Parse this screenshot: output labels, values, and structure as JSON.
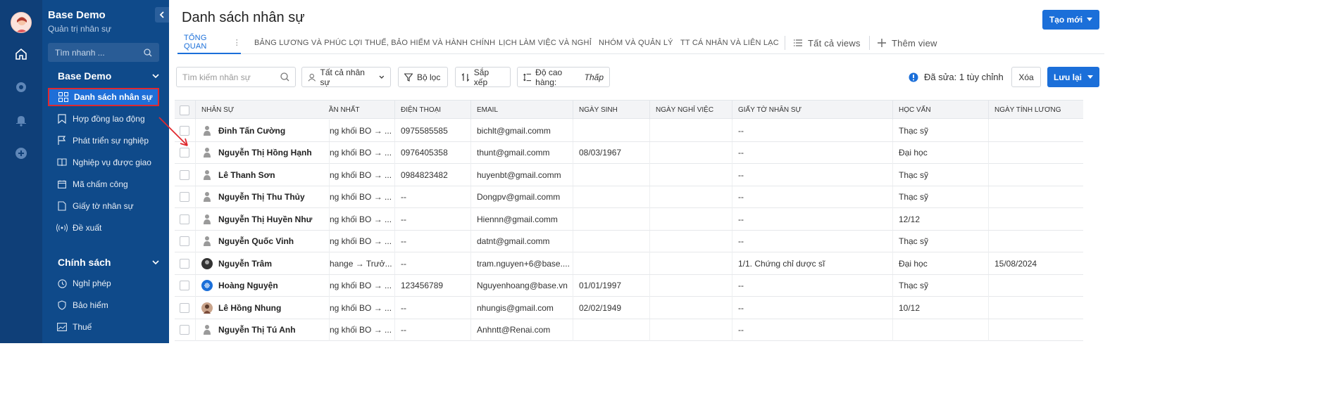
{
  "app": {
    "title": "Base Demo",
    "subtitle": "Quản trị nhân sự"
  },
  "sidebar": {
    "search_placeholder": "Tìm nhanh ...",
    "group1": "Base Demo",
    "items": [
      {
        "label": "Danh sách nhân sự",
        "icon": "grid-icon"
      },
      {
        "label": "Hợp đồng lao động",
        "icon": "bookmark-icon"
      },
      {
        "label": "Phát triển sự nghiệp",
        "icon": "flag-icon"
      },
      {
        "label": "Nghiệp vụ được giao",
        "icon": "book-icon"
      },
      {
        "label": "Mã chấm công",
        "icon": "calendar-icon"
      },
      {
        "label": "Giấy tờ nhân sự",
        "icon": "document-icon"
      },
      {
        "label": "Đề xuất",
        "icon": "broadcast-icon"
      }
    ],
    "group2": "Chính sách",
    "items2": [
      {
        "label": "Nghỉ phép",
        "icon": "clock-icon"
      },
      {
        "label": "Bảo hiểm",
        "icon": "shield-icon"
      },
      {
        "label": "Thuế",
        "icon": "image-icon"
      }
    ]
  },
  "main": {
    "title": "Danh sách nhân sự",
    "create_button": "Tạo mới",
    "tabs": [
      "TỔNG QUAN",
      "BẢNG LƯƠNG VÀ PHÚC LỢI",
      "THUẾ, BẢO HIỂM VÀ HÀNH CHÍNH",
      "LỊCH LÀM VIỆC VÀ NGHỈ",
      "NHÓM VÀ QUẢN LÝ",
      "TT CÁ NHÂN VÀ LIÊN LẠC"
    ],
    "all_views": "Tất cả views",
    "add_view": "Thêm view"
  },
  "toolbar": {
    "search_placeholder": "Tìm kiếm nhân sự",
    "all_staff": "Tất cả nhân sự",
    "filter": "Bộ lọc",
    "sort": "Sắp xếp",
    "row_height_label": "Độ cao hàng:",
    "row_height_value": "Thấp",
    "edited_text": "Đã sửa: 1 tùy chỉnh",
    "delete": "Xóa",
    "save": "Lưu lại"
  },
  "table": {
    "headers": [
      "NHÂN SỰ",
      "GẦN NHẤT",
      "ĐIỆN THOẠI",
      "EMAIL",
      "NGÀY SINH",
      "NGÀY NGHỈ VIỆC",
      "GIẤY TỜ NHÂN SỰ",
      "HỌC VẤN",
      "NGÀY TÍNH LƯƠNG"
    ],
    "header_visible": [
      "NHÂN SỰ",
      "GẦN NHẤT",
      "ĐIỆN THOẠI",
      "EMAIL",
      "NGÀY SINH",
      "NGÀY NGHỈ VIỆC",
      "GIẤY TỜ NHÂN SỰ",
      "HỌC VẤN",
      "NGÀY TÍNH LƯƠNG"
    ],
    "rows": [
      [
        "Đinh Tấn Cường",
        "ng khối BO → ...",
        "0975585585",
        "bichlt@gmail.comm",
        "",
        "",
        "--",
        "Thạc sỹ",
        ""
      ],
      [
        "Nguyễn Thị Hồng Hạnh",
        "ng khối BO → ...",
        "0976405358",
        "thunt@gmail.comm",
        "08/03/1967",
        "",
        "--",
        "Đại học",
        ""
      ],
      [
        "Lê Thanh Sơn",
        "ng khối BO → ...",
        "0984823482",
        "huyenbt@gmail.comm",
        "",
        "",
        "--",
        "Thạc sỹ",
        ""
      ],
      [
        "Nguyễn Thị Thu Thủy",
        "ng khối BO → ...",
        "--",
        "Dongpv@gmail.comm",
        "",
        "",
        "--",
        "Thạc sỹ",
        ""
      ],
      [
        "Nguyễn Thị Huyền Như",
        "ng khối BO → ...",
        "--",
        "Hiennn@gmail.comm",
        "",
        "",
        "--",
        "12/12",
        ""
      ],
      [
        "Nguyễn Quốc Vinh",
        "ng khối BO → ...",
        "--",
        "datnt@gmail.comm",
        "",
        "",
        "--",
        "Thạc sỹ",
        ""
      ],
      [
        "Nguyễn Trâm",
        "hange → Trưở...",
        "--",
        "tram.nguyen+6@base....",
        "",
        "",
        "1/1. Chứng chỉ dược sĩ",
        "Đại học",
        "15/08/2024"
      ],
      [
        "Hoàng Nguyện",
        "ng khối BO → ...",
        "123456789",
        "Nguyenhoang@base.vn",
        "01/01/1997",
        "",
        "--",
        "Thạc sỹ",
        ""
      ],
      [
        "Lê Hồng Nhung",
        "ng khối BO → ...",
        "--",
        "nhungis@gmail.com",
        "02/02/1949",
        "",
        "--",
        "10/12",
        ""
      ],
      [
        "Nguyễn Thị Tú Anh",
        "ng khối BO → ...",
        "--",
        "Anhntt@Renai.com",
        "",
        "",
        "--",
        "",
        ""
      ]
    ],
    "avatar_types": [
      "person",
      "person",
      "person",
      "person",
      "person",
      "person",
      "dark",
      "blue",
      "photo",
      "person"
    ]
  },
  "colors": {
    "rail": "#0f3f78",
    "sidebar": "#0f4a8a",
    "accent": "#1b6fd9",
    "highlight_border": "#e0282e"
  }
}
